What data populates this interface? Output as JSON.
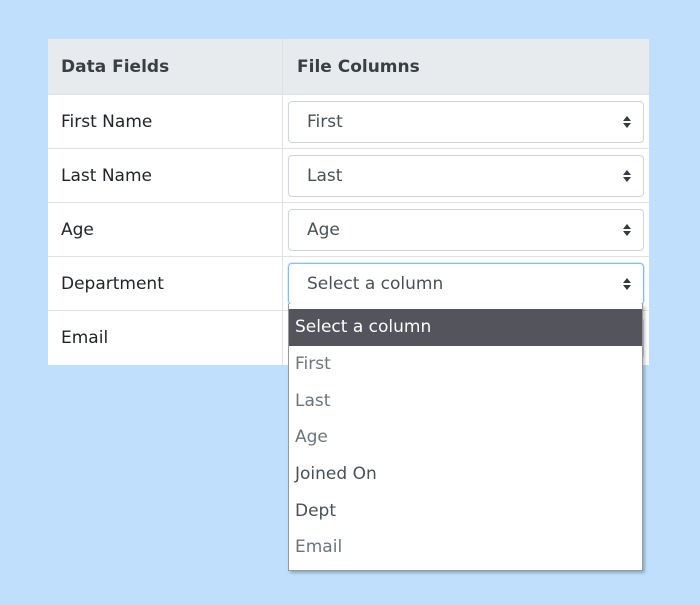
{
  "table": {
    "headers": [
      "Data Fields",
      "File Columns"
    ],
    "rows": [
      {
        "field": "First Name",
        "column": "First"
      },
      {
        "field": "Last Name",
        "column": "Last"
      },
      {
        "field": "Age",
        "column": "Age"
      },
      {
        "field": "Department",
        "column": "Select a column"
      },
      {
        "field": "Email",
        "column": ""
      }
    ]
  },
  "dropdown": {
    "options": [
      "Select a column",
      "First",
      "Last",
      "Age",
      "Joined On",
      "Dept",
      "Email"
    ],
    "selected": "Select a column"
  },
  "colors": {
    "page_background": "#bfdffd",
    "header_background": "#e8ebee",
    "selected_option": "#54545c"
  }
}
